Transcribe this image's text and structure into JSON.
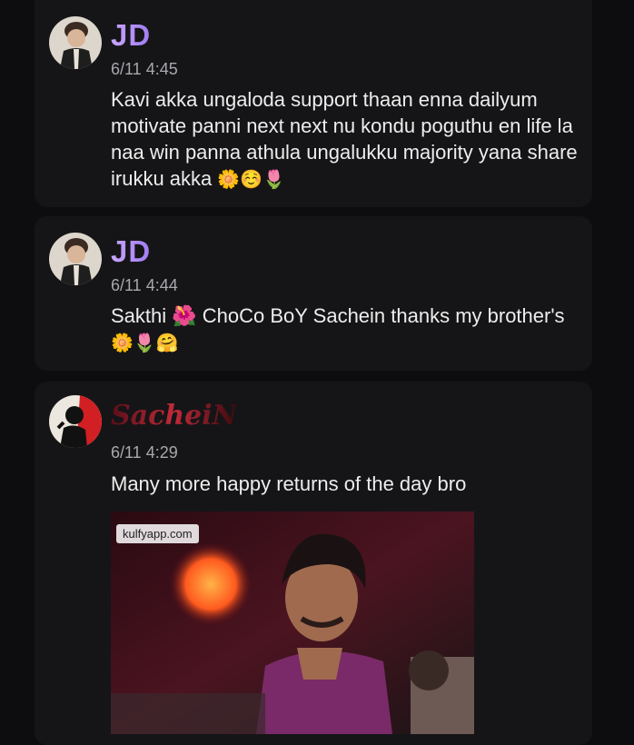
{
  "messages": [
    {
      "author": "JD",
      "time": "6/11 4:45",
      "text": "Kavi akka ungaloda support thaan enna dailyum motivate panni next next nu kondu poguthu en life la naa win panna athula ungalukku majority yana share irukku akka",
      "emojis": "🌼☺️🌷"
    },
    {
      "author": "JD",
      "time": "6/11 4:44",
      "text": "Sakthi 🌺 ChoCo BoY Sachein thanks my brother's",
      "emojis": "🌼🌷🤗"
    },
    {
      "author": "SacheiN",
      "time": "6/11 4:29",
      "text": "Many more happy returns of the day bro",
      "gif_watermark": "kulfyapp.com"
    }
  ],
  "icons": {
    "avatar1": "avatar-icon",
    "avatar2": "avatar-icon",
    "avatar3": "avatar-silhouette-icon"
  }
}
